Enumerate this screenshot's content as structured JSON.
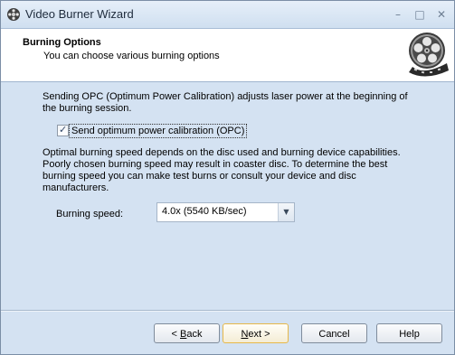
{
  "window": {
    "title": "Video Burner Wizard",
    "icon": "burner-app-icon",
    "controls": {
      "minimize": "–",
      "maximize": "□",
      "close": "✕"
    }
  },
  "header": {
    "title": "Burning Options",
    "subtitle": "You can choose various burning options",
    "graphic": "film-reel-icon"
  },
  "body": {
    "opc_description": "Sending OPC (Optimum Power Calibration) adjusts laser power at the beginning of the burning session.",
    "opc_checkbox": {
      "label": "Send optimum power calibration (OPC)",
      "checked": true
    },
    "speed_description": "Optimal burning speed depends on the disc used and burning device capabilities. Poorly chosen burning speed may result in coaster disc. To determine the best burning speed you can make test burns or consult your device and disc manufacturers.",
    "speed_label": "Burning speed:",
    "speed_value": "4.0x (5540 KB/sec)"
  },
  "buttons": {
    "back_prefix": "< ",
    "back_accel": "B",
    "back_rest": "ack",
    "next_accel": "N",
    "next_rest": "ext >",
    "cancel": "Cancel",
    "help": "Help"
  },
  "colors": {
    "window_bg": "#d4e2f2",
    "header_bg": "#ffffff",
    "default_button_border": "#e6b84a"
  }
}
